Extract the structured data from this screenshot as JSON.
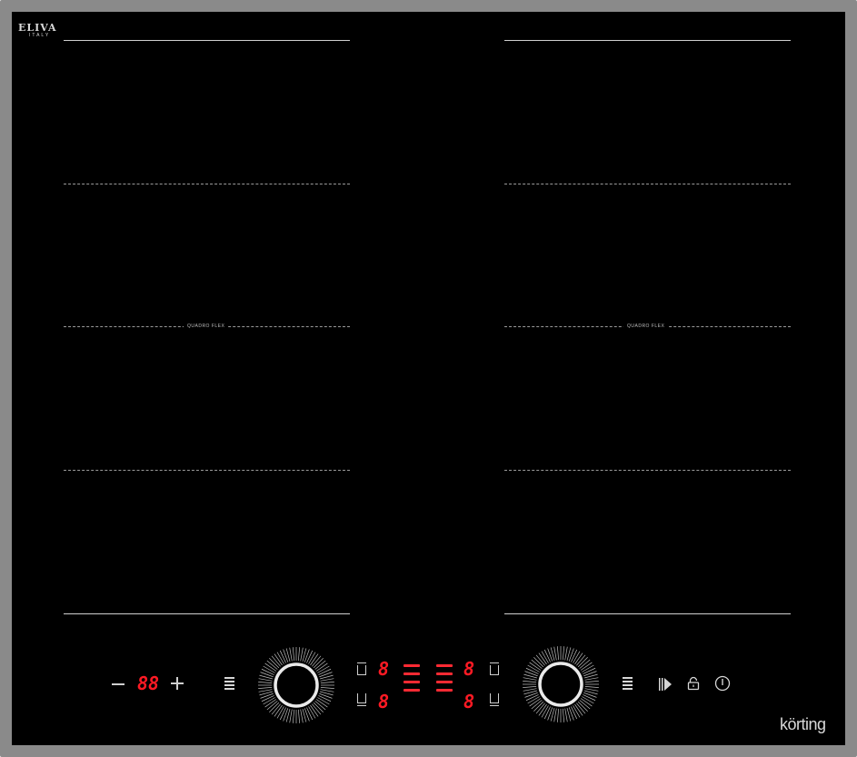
{
  "brand": {
    "name": "ELIVA",
    "subtitle": "ITALY"
  },
  "zones": {
    "left_label": "QUADRO FLEX",
    "right_label": "QUADRO FLEX"
  },
  "controls": {
    "timer_display": "88",
    "left_zone_top_display": "8",
    "left_zone_bottom_display": "8",
    "right_zone_top_display": "8",
    "right_zone_bottom_display": "8"
  },
  "logo": "körting",
  "colors": {
    "glass": "#000000",
    "frame": "#8a8a8a",
    "display_red": "#ff1a24",
    "line": "#cfcfcf"
  },
  "icons": [
    "minus-icon",
    "plus-icon",
    "menu-icon",
    "slider-dial-icon",
    "zone-indicator-icon",
    "pause-icon",
    "lock-icon",
    "power-icon"
  ]
}
